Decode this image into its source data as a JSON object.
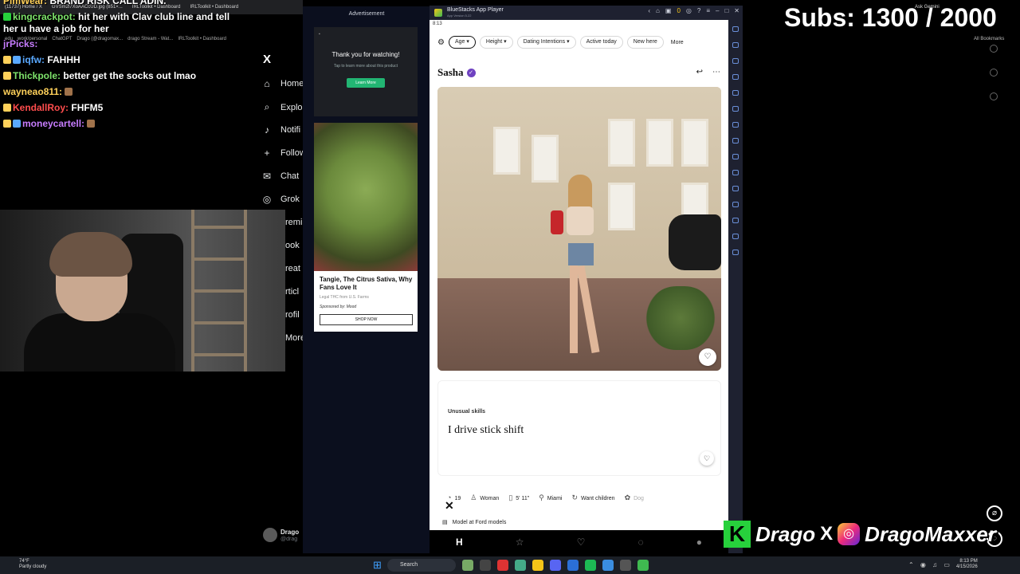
{
  "browser": {
    "tabs": [
      "(11737) Home / X",
      "GVSm2l7XoAACcUD.jpg (851×...",
      "IRLToolkit • Dashboard",
      "IRLToolkit • Dashboard"
    ],
    "bookmarks": [
      "edu",
      "work/personal",
      "ChatGPT",
      "Drago (@dragomax...",
      "drago Stream - Wat...",
      "IRLToolkit • Dashboard"
    ],
    "all_bookmarks": "All Bookmarks",
    "ask_gemini": "Ask Gemini"
  },
  "x_nav": {
    "logo": "X",
    "items": [
      {
        "icon": "home-icon",
        "label": "Home"
      },
      {
        "icon": "search-icon",
        "label": "Explo"
      },
      {
        "icon": "bell-icon",
        "label": "Notifi"
      },
      {
        "icon": "follow-icon",
        "label": "Follow"
      },
      {
        "icon": "chat-icon",
        "label": "Chat"
      },
      {
        "icon": "grok-icon",
        "label": "Grok"
      }
    ],
    "subitems": [
      "remi",
      "ook",
      "reat",
      "rticl",
      "rofil",
      "More"
    ],
    "profile_name": "Drago",
    "profile_handle": "@drag"
  },
  "chat": [
    {
      "user": "PimWear:",
      "text": "BRAND RISK CALL ADIN.",
      "color": "u3"
    },
    {
      "user": "kingcrackpot:",
      "text": "hit her with Clav club line and tell",
      "color": "u1"
    },
    {
      "user": "",
      "text": "her u have a job for her",
      "color": "u1"
    },
    {
      "user": "jrPicks:",
      "text": "",
      "color": "u5"
    },
    {
      "user": "iqfw:",
      "text": "FAHHH",
      "color": "u2"
    },
    {
      "user": "Thickpole:",
      "text": "better get the socks out lmao",
      "color": "u1"
    },
    {
      "user": "wayneao811:",
      "text": "",
      "color": "u3"
    },
    {
      "user": "KendallRoy:",
      "text": "FHFM5",
      "color": "u4"
    },
    {
      "user": "moneycartell:",
      "text": "",
      "color": "u5"
    }
  ],
  "ads": {
    "header": "Advertisement",
    "ad1": {
      "title": "Thank you for watching!",
      "sub": "Tap to learn more about this product",
      "button": "Learn More"
    },
    "ad2": {
      "title": "Tangie, The Citrus Sativa, Why Fans Love It",
      "sub1": "Legal THC from U.S. Farms",
      "sub2": "Sponsored by: Mood",
      "button": "SHOP NOW"
    }
  },
  "bluestacks": {
    "title": "BlueStacks App Player",
    "subtitle": "App Version 5.22",
    "coins": "0",
    "status_time": "8:13",
    "filters": [
      "Age",
      "Height",
      "Dating Intentions",
      "Active today",
      "New here"
    ],
    "more": "More",
    "profile": {
      "name": "Sasha",
      "prompt_question": "Unusual skills",
      "prompt_answer": "I drive stick shift",
      "vitals": [
        "19",
        "Woman",
        "5' 11\"",
        "Miami",
        "Want children",
        "Dog"
      ],
      "job": "Model at Ford models"
    }
  },
  "overlay": {
    "subs": "Subs: 1300 / 2000",
    "brand_handle": "Drago",
    "brand_social": "DragoMaxxer",
    "brand_k": "K"
  },
  "taskbar": {
    "weather_temp": "74°F",
    "weather_desc": "Partly cloudy",
    "search": "Search",
    "time": "8:13 PM",
    "date": "4/15/2026"
  },
  "colors": {
    "accent_green": "#27d13c",
    "hinge_purple": "#6f42c1",
    "ad_green": "#22b573"
  }
}
